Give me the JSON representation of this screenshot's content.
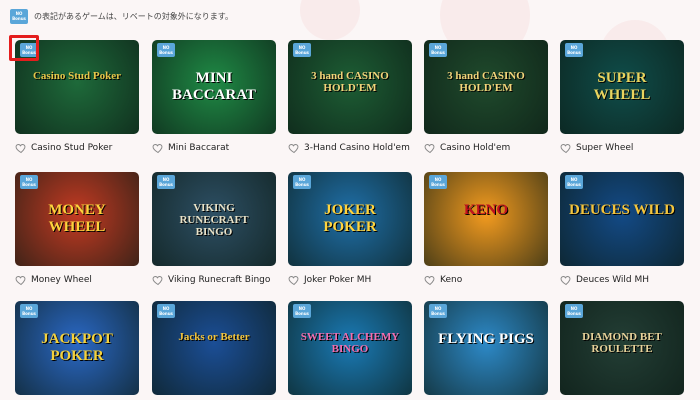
{
  "notice": {
    "badge_top": "NO",
    "badge_bottom": "Bonus",
    "text": "の表記があるゲームは、リベートの対象外になります。"
  },
  "badge": {
    "top": "NO",
    "bottom": "Bonus"
  },
  "games": [
    {
      "title": "Casino Stud Poker",
      "art_text": "Casino Stud Poker",
      "bg": "#1e6a3a",
      "fg": "#e7c64a",
      "highlighted": true
    },
    {
      "title": "Mini Baccarat",
      "art_text": "MINI BACCARAT",
      "bg": "#1f8a45",
      "fg": "#ffffff"
    },
    {
      "title": "3-Hand Casino Hold'em",
      "art_text": "3 hand CASINO HOLD'EM",
      "bg": "#1d5d34",
      "fg": "#f2d47a"
    },
    {
      "title": "Casino Hold'em",
      "art_text": "3 hand CASINO HOLD'EM",
      "bg": "#1f4a2c",
      "fg": "#f2d47a"
    },
    {
      "title": "Super Wheel",
      "art_text": "SUPER WHEEL",
      "bg": "#0f4d4a",
      "fg": "#e8d45f"
    },
    {
      "title": "Money Wheel",
      "art_text": "MONEY WHEEL",
      "bg": "#c33a22",
      "fg": "#ffd23c"
    },
    {
      "title": "Viking Runecraft Bingo",
      "art_text": "VIKING RUNECRAFT BINGO",
      "bg": "#2d4f64",
      "fg": "#e8e2c8"
    },
    {
      "title": "Joker Poker MH",
      "art_text": "JOKER POKER",
      "bg": "#1f6fa8",
      "fg": "#ffd43f"
    },
    {
      "title": "Keno",
      "art_text": "KENO",
      "bg": "#f39b1f",
      "fg": "#c4121e"
    },
    {
      "title": "Deuces Wild MH",
      "art_text": "DEUCES WILD",
      "bg": "#134a86",
      "fg": "#f4c53d"
    },
    {
      "title": "",
      "art_text": "JACKPOT POKER",
      "bg": "#2a68c5",
      "fg": "#f4d23d"
    },
    {
      "title": "",
      "art_text": "Jacks or Better",
      "bg": "#1b4e96",
      "fg": "#f4c53d"
    },
    {
      "title": "",
      "art_text": "SWEET ALCHEMY BINGO",
      "bg": "#1a7ab5",
      "fg": "#f36dae"
    },
    {
      "title": "",
      "art_text": "FLYING PIGS",
      "bg": "#2d89c7",
      "fg": "#ffffff"
    },
    {
      "title": "",
      "art_text": "DIAMOND BET ROULETTE",
      "bg": "#233e35",
      "fg": "#e7d29a"
    }
  ]
}
